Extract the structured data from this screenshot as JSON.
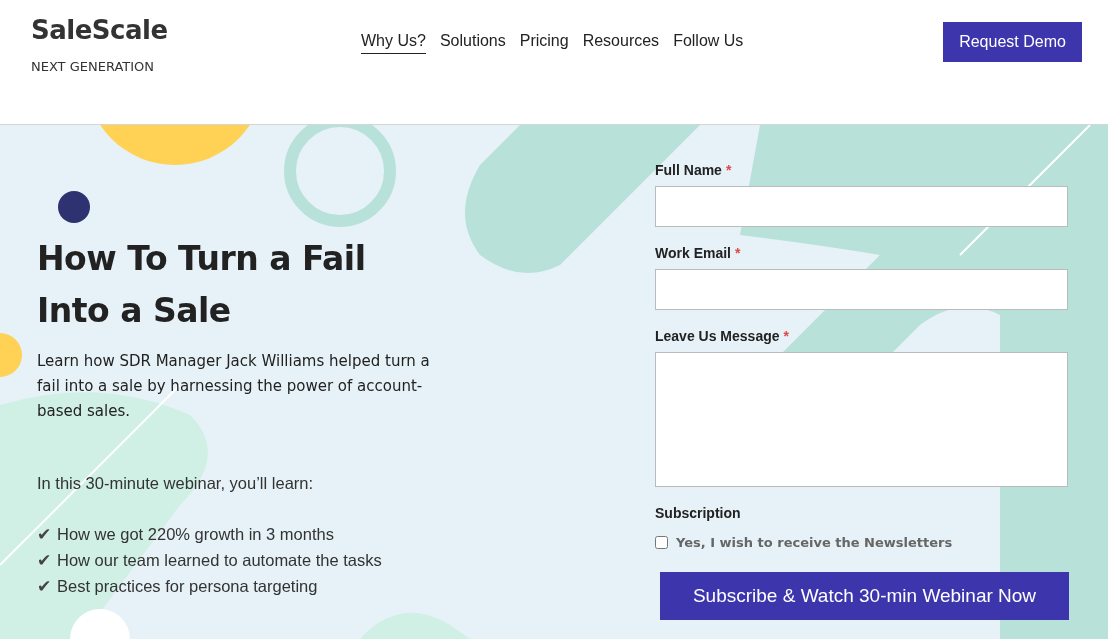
{
  "brand": {
    "name": "SaleScale",
    "tagline": "NEXT GENERATION"
  },
  "nav": [
    {
      "label": "Why Us?",
      "selected": true
    },
    {
      "label": "Solutions",
      "selected": false
    },
    {
      "label": "Pricing",
      "selected": false
    },
    {
      "label": "Resources",
      "selected": false
    },
    {
      "label": "Follow Us",
      "selected": false
    }
  ],
  "cta": "Request Demo",
  "hero": {
    "title": "How To Turn a Fail Into a Sale",
    "intro": "Learn how SDR Manager Jack Williams helped turn a fail into a sale by harnessing the power of account-based sales.",
    "lead": "In this 30-minute webinar, you’ll learn:",
    "points": [
      {
        "icon": "✔",
        "text": "How we got 220% growth in 3 months"
      },
      {
        "icon": "✔",
        "text": "How our team learned to automate the tasks"
      },
      {
        "icon": "✔",
        "text": "Best practices for persona targeting"
      }
    ]
  },
  "form": {
    "fields": [
      {
        "label": "Full Name",
        "required_mark": "*",
        "kind": "text"
      },
      {
        "label": "Work Email",
        "required_mark": "*",
        "kind": "text"
      },
      {
        "label": "Leave Us Message",
        "required_mark": "*",
        "kind": "textarea"
      }
    ],
    "subscription": {
      "label": "Subscription",
      "option": "Yes, I wish to receive the Newsletters",
      "checked": false
    },
    "submit": "Subscribe & Watch 30-min Webinar Now"
  }
}
